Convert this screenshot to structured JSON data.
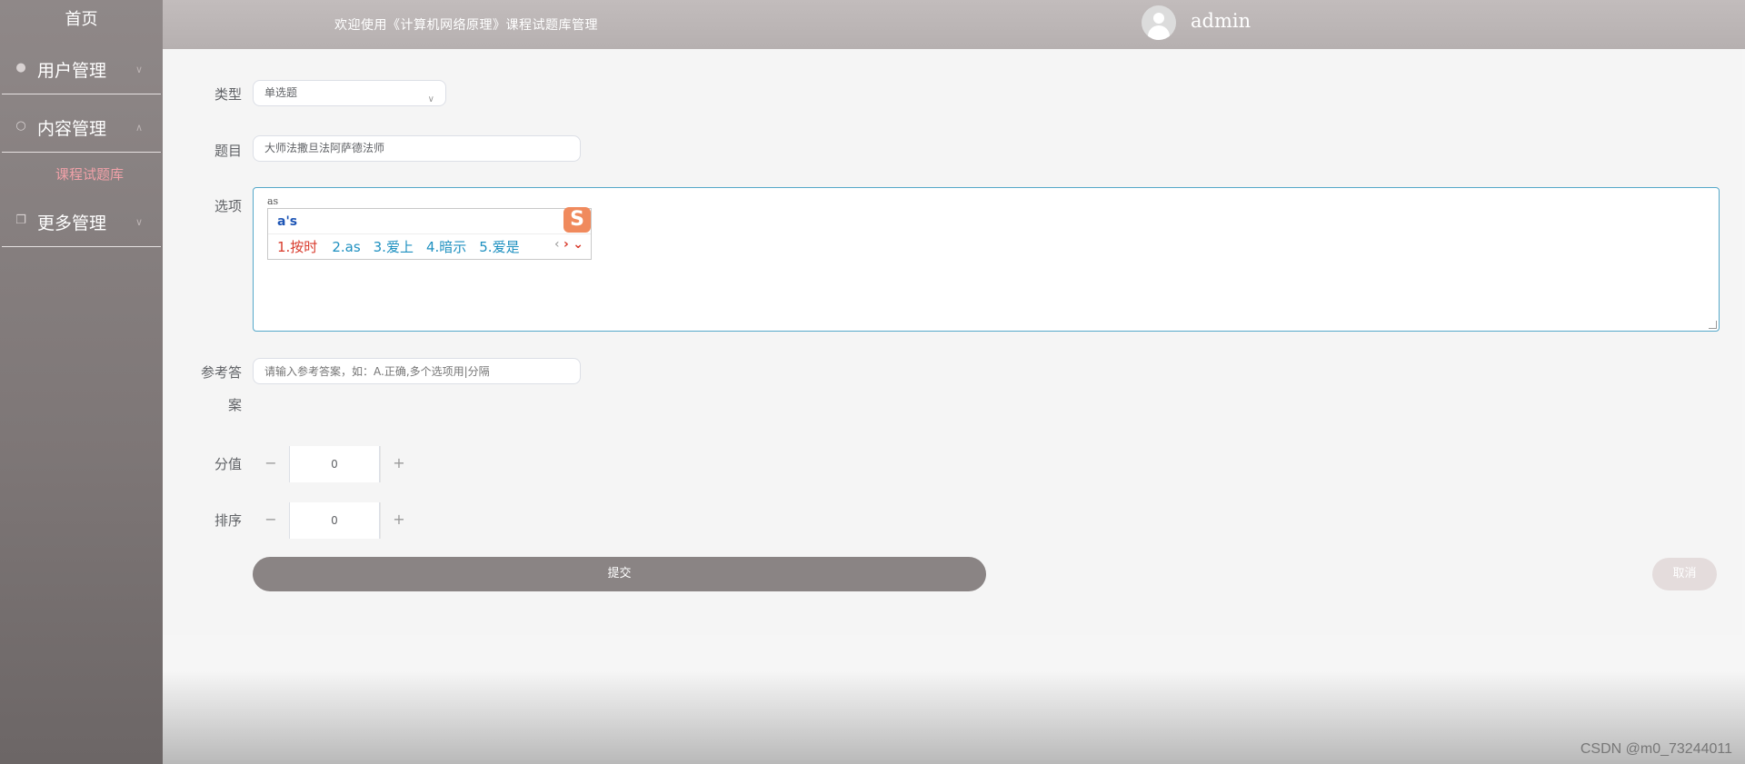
{
  "sidebar": {
    "home": "首页",
    "items": [
      {
        "label": "用户管理",
        "icon": "user-icon"
      },
      {
        "label": "内容管理",
        "icon": "message-icon"
      },
      {
        "label": "更多管理",
        "icon": "copy-icon"
      }
    ],
    "submenu_item": "课程试题库"
  },
  "header": {
    "title": "欢迎使用《计算机网络原理》课程试题库管理",
    "username": "admin"
  },
  "form": {
    "type_label": "类型",
    "type_value": "单选题",
    "question_label": "题目",
    "question_value": "大师法撒旦法阿萨德法师",
    "options_label": "选项",
    "options_value": "as",
    "answer_label_1": "参考答",
    "answer_label_2": "案",
    "answer_placeholder": "请输入参考答案，如：A.正确,多个选项用|分隔",
    "score_label": "分值",
    "score_value": "0",
    "order_label": "排序",
    "order_value": "0",
    "submit": "提交",
    "cancel": "取消"
  },
  "ime": {
    "composition": "a's",
    "candidates": [
      "1.按时",
      "2.as",
      "3.爱上",
      "4.暗示",
      "5.爱是"
    ],
    "logo": "S"
  },
  "stepper": {
    "minus": "−",
    "plus": "+"
  },
  "watermark": "CSDN @m0_73244011",
  "colors": {
    "sidebar": "#8f8888",
    "header": "#bdb7b7",
    "accent": "#f0a1a8",
    "submit": "#8a8484"
  }
}
